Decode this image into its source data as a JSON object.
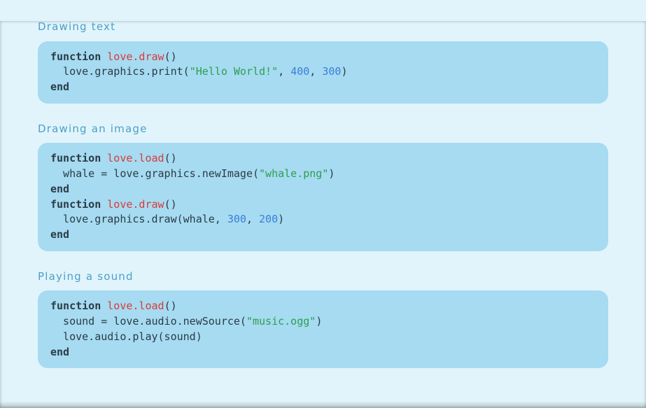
{
  "sections": [
    {
      "title": "Drawing text",
      "code": [
        {
          "t": "kw",
          "v": "function"
        },
        {
          "t": "sp",
          "v": " "
        },
        {
          "t": "fn",
          "v": "love.draw"
        },
        {
          "t": "p",
          "v": "()"
        },
        {
          "t": "nl"
        },
        {
          "t": "p",
          "v": "  love.graphics.print("
        },
        {
          "t": "str",
          "v": "\"Hello World!\""
        },
        {
          "t": "p",
          "v": ", "
        },
        {
          "t": "num",
          "v": "400"
        },
        {
          "t": "p",
          "v": ", "
        },
        {
          "t": "num",
          "v": "300"
        },
        {
          "t": "p",
          "v": ")"
        },
        {
          "t": "nl"
        },
        {
          "t": "kw",
          "v": "end"
        }
      ]
    },
    {
      "title": "Drawing an image",
      "code": [
        {
          "t": "kw",
          "v": "function"
        },
        {
          "t": "sp",
          "v": " "
        },
        {
          "t": "fn",
          "v": "love.load"
        },
        {
          "t": "p",
          "v": "()"
        },
        {
          "t": "nl"
        },
        {
          "t": "p",
          "v": "  whale = love.graphics.newImage("
        },
        {
          "t": "str",
          "v": "\"whale.png\""
        },
        {
          "t": "p",
          "v": ")"
        },
        {
          "t": "nl"
        },
        {
          "t": "kw",
          "v": "end"
        },
        {
          "t": "nl"
        },
        {
          "t": "kw",
          "v": "function"
        },
        {
          "t": "sp",
          "v": " "
        },
        {
          "t": "fn",
          "v": "love.draw"
        },
        {
          "t": "p",
          "v": "()"
        },
        {
          "t": "nl"
        },
        {
          "t": "p",
          "v": "  love.graphics.draw(whale, "
        },
        {
          "t": "num",
          "v": "300"
        },
        {
          "t": "p",
          "v": ", "
        },
        {
          "t": "num",
          "v": "200"
        },
        {
          "t": "p",
          "v": ")"
        },
        {
          "t": "nl"
        },
        {
          "t": "kw",
          "v": "end"
        }
      ]
    },
    {
      "title": "Playing a sound",
      "code": [
        {
          "t": "kw",
          "v": "function"
        },
        {
          "t": "sp",
          "v": " "
        },
        {
          "t": "fn",
          "v": "love.load"
        },
        {
          "t": "p",
          "v": "()"
        },
        {
          "t": "nl"
        },
        {
          "t": "p",
          "v": "  sound = love.audio.newSource("
        },
        {
          "t": "str",
          "v": "\"music.ogg\""
        },
        {
          "t": "p",
          "v": ")"
        },
        {
          "t": "nl"
        },
        {
          "t": "p",
          "v": "  love.audio.play(sound)"
        },
        {
          "t": "nl"
        },
        {
          "t": "kw",
          "v": "end"
        }
      ]
    }
  ]
}
